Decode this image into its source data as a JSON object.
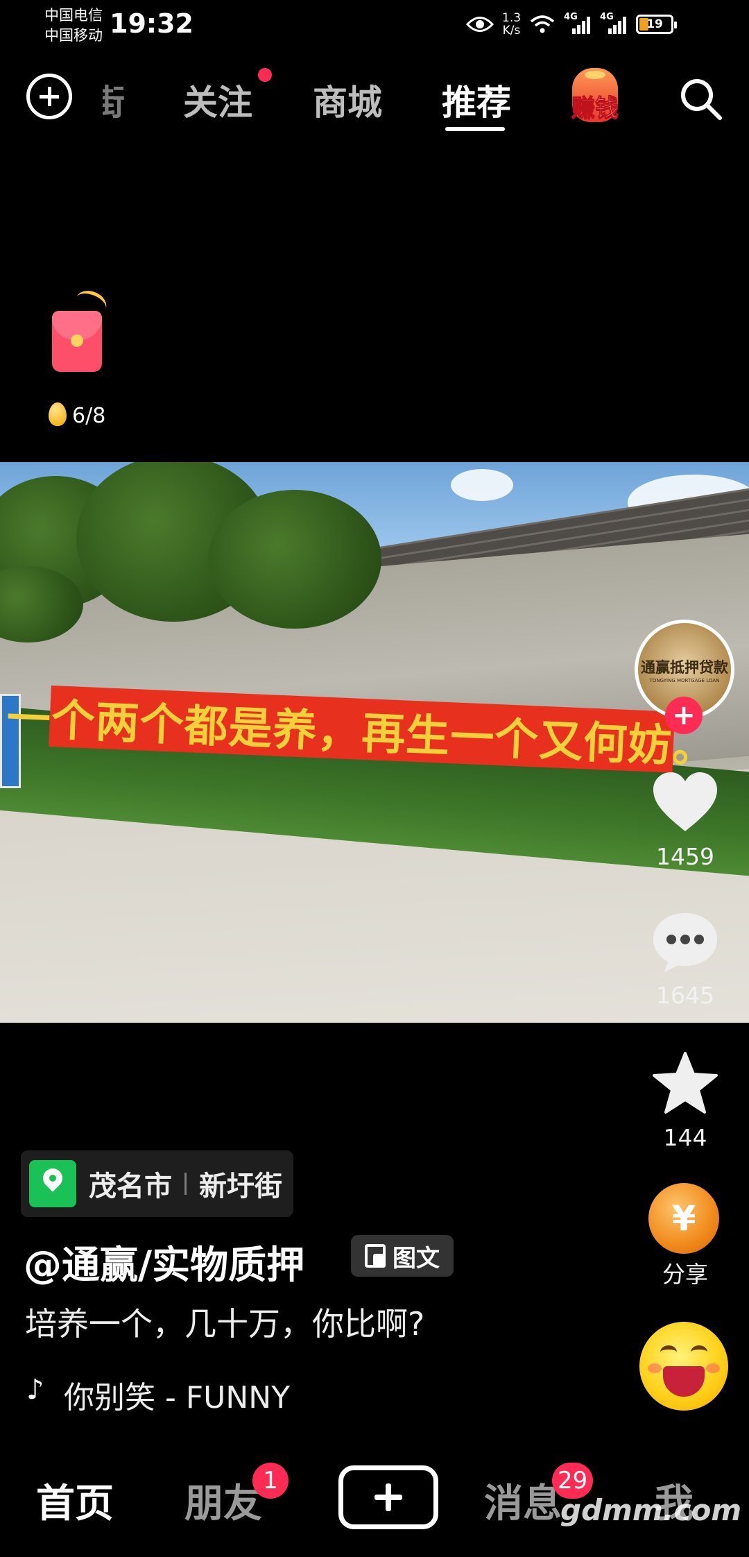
{
  "status_bar": {
    "carriers": [
      "中国电信",
      "中国移动"
    ],
    "time": "19:32",
    "network_speed_value": "1.3",
    "network_speed_unit": "K/s",
    "signal_1_label": "4G",
    "signal_2_label": "4G",
    "battery_level": "19"
  },
  "top_nav": {
    "partial_tab": "街",
    "tabs": [
      {
        "label": "关注",
        "has_dot": true
      },
      {
        "label": "商城"
      },
      {
        "label": "推荐",
        "active": true
      }
    ],
    "earn_label": "赚钱"
  },
  "reward_widget": {
    "progress_text": "6/8"
  },
  "post": {
    "banner_text": "一个两个都是养，再生一个又何妨。",
    "author_avatar_text": "通赢抵押贷款",
    "author_avatar_subtext": "TONGYING MORTGAGE LOAN",
    "follow_symbol": "+",
    "likes": "1459",
    "comments": "1645",
    "favorites": "144",
    "share_label": "分享",
    "share_symbol": "¥",
    "location_city": "茂名市",
    "location_street": "新圩街",
    "author": "@通赢/实物质押",
    "post_type_tag": "图文",
    "description": "培养一个，几十万，你比啊?",
    "music_symbol": "♪",
    "music": "你别笑 - FUNNY"
  },
  "bottom_nav": {
    "items": [
      {
        "label": "首页",
        "active": true
      },
      {
        "label": "朋友",
        "badge": "1"
      },
      {
        "label": "消息",
        "badge": "29"
      },
      {
        "label": "我"
      }
    ]
  },
  "watermark": "gdmm.com",
  "colors": {
    "accent": "#fe2c55",
    "banner_red": "#e8301e",
    "banner_text": "#f4d13a",
    "location_green": "#19c156"
  }
}
